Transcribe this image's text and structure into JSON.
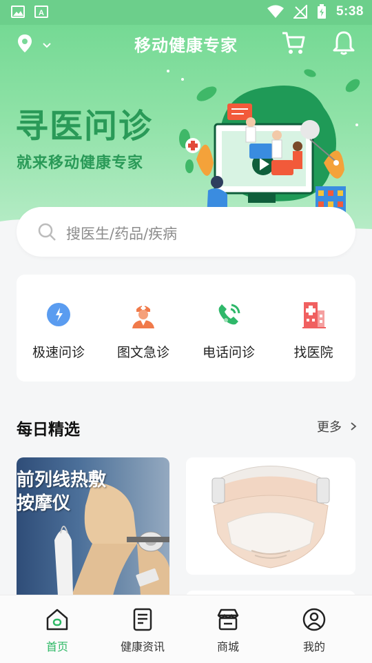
{
  "status_bar": {
    "time": "5:38"
  },
  "header": {
    "title": "移动健康专家"
  },
  "banner": {
    "title": "寻医问诊",
    "subtitle": "就来移动健康专家"
  },
  "search": {
    "placeholder": "搜医生/药品/疾病"
  },
  "services": [
    {
      "label": "极速问诊",
      "icon": "speech-bubble-icon"
    },
    {
      "label": "图文急诊",
      "icon": "nurse-icon"
    },
    {
      "label": "电话问诊",
      "icon": "phone-call-icon"
    },
    {
      "label": "找医院",
      "icon": "hospital-icon"
    }
  ],
  "daily": {
    "title": "每日精选",
    "more": "更多",
    "products": [
      {
        "caption_line1": "前列线热敷",
        "caption_line2": "按摩仪"
      }
    ]
  },
  "tabs": [
    {
      "label": "首页",
      "active": true
    },
    {
      "label": "健康资讯",
      "active": false
    },
    {
      "label": "商城",
      "active": false
    },
    {
      "label": "我的",
      "active": false
    }
  ],
  "colors": {
    "accent": "#2db865",
    "banner_text": "#2a9a58",
    "hero_bg": "#75d994"
  }
}
